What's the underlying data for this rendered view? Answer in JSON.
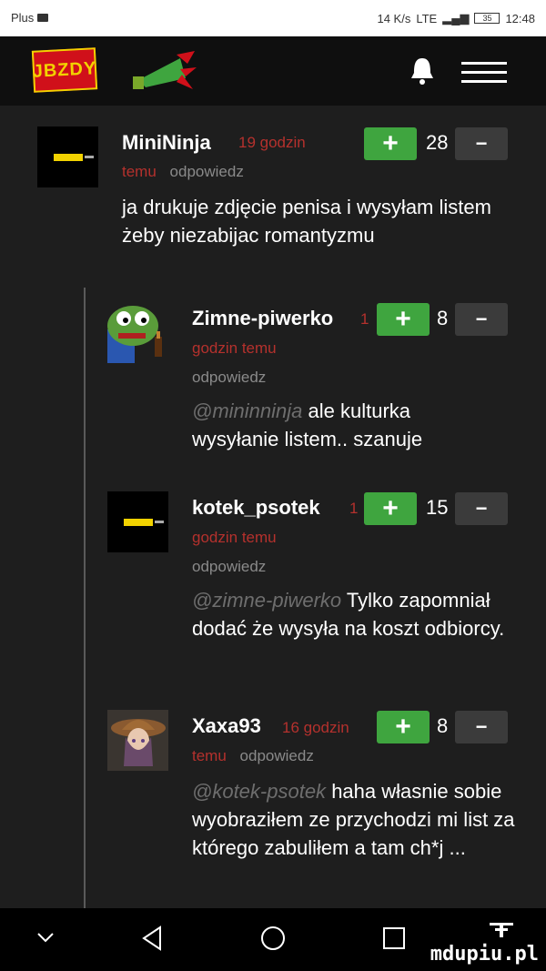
{
  "status_bar": {
    "carrier": "Plus",
    "speed": "14 K/s",
    "network": "LTE",
    "battery": "35",
    "time": "12:48"
  },
  "header": {
    "logo_text": "JBZDY"
  },
  "comments": [
    {
      "author": "MiniNinja",
      "time_prefix": "19 godzin",
      "time_suffix": "temu",
      "reply": "odpowiedz",
      "score": "28",
      "mention": "",
      "text": "ja drukuje zdjęcie penisa i wysyłam listem żeby niezabijac romantyzmu"
    },
    {
      "author": "Zimne-piwerko",
      "time_prefix": "1",
      "time_suffix": "godzin temu",
      "reply": "odpowiedz",
      "score": "8",
      "mention": "@mininninja",
      "text": "ale kulturka wysyłanie listem.. szanuje"
    },
    {
      "author": "kotek_psotek",
      "time_prefix": "1",
      "time_suffix": "godzin temu",
      "reply": "odpowiedz",
      "score": "15",
      "mention": "@zimne-piwerko",
      "text": "Tylko zapomniał dodać że wysyła na koszt odbiorcy."
    },
    {
      "author": "Xaxa93",
      "time_prefix": "16 godzin",
      "time_suffix": "temu",
      "reply": "odpowiedz",
      "score": "8",
      "mention": "@kotek-psotek",
      "text": "haha własnie sobie wyobraziłem ze przychodzi mi list za którego zabuliłem a tam ch*j ..."
    }
  ],
  "buttons": {
    "plus": "+",
    "minus": "−"
  },
  "watermark": "mdupiu.pl"
}
